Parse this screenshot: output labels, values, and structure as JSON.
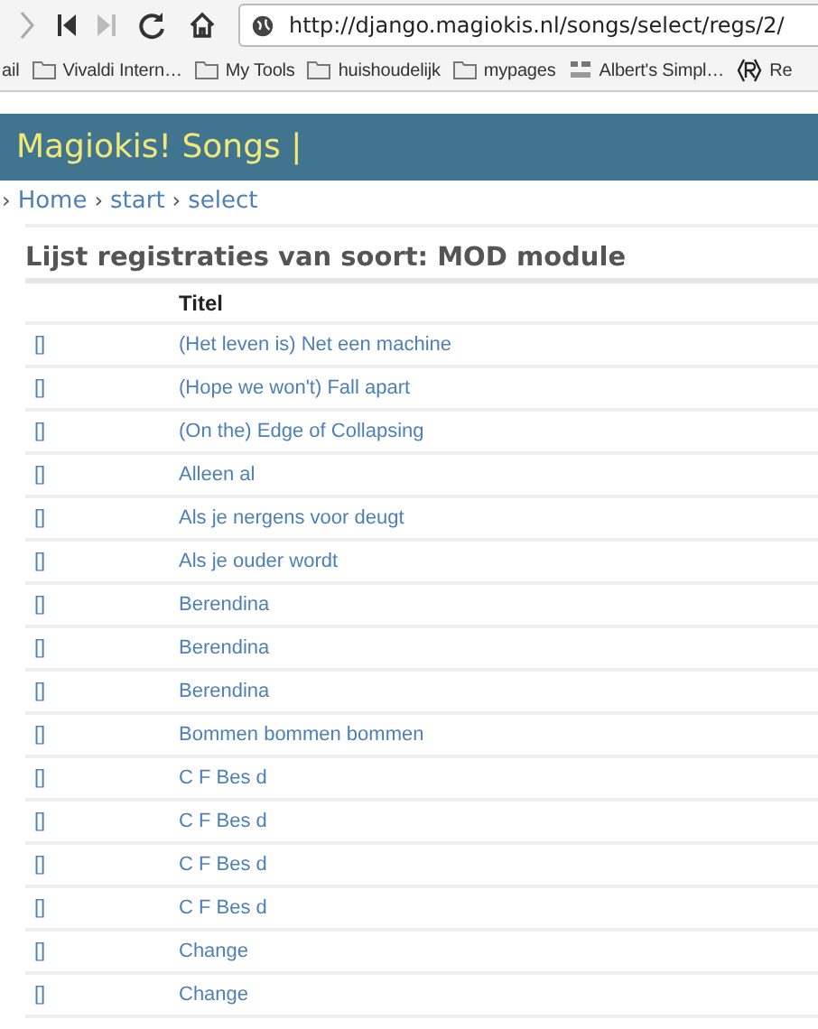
{
  "browser": {
    "url": "http://django.magiokis.nl/songs/select/regs/2/",
    "bookmarks": [
      {
        "label": "ail",
        "kind": "plain"
      },
      {
        "label": "Vivaldi Intern…",
        "kind": "folder"
      },
      {
        "label": "My Tools",
        "kind": "folder"
      },
      {
        "label": "huishoudelijk",
        "kind": "folder"
      },
      {
        "label": "mypages",
        "kind": "folder"
      },
      {
        "label": "Albert's Simpl…",
        "kind": "site"
      },
      {
        "label": "Re",
        "kind": "registered"
      }
    ]
  },
  "header": {
    "title": "Magiokis! Songs |"
  },
  "breadcrumb": {
    "separator": "›",
    "items": [
      "Home",
      "start",
      "select"
    ]
  },
  "heading": "Lijst registraties van soort: MOD module",
  "table": {
    "columns": [
      "Titel"
    ],
    "rows": [
      {
        "link": "[]",
        "title": "(Het leven is) Net een machine"
      },
      {
        "link": "[]",
        "title": "(Hope we won't) Fall apart"
      },
      {
        "link": "[]",
        "title": "(On the) Edge of Collapsing"
      },
      {
        "link": "[]",
        "title": "Alleen al"
      },
      {
        "link": "[]",
        "title": "Als je nergens voor deugt"
      },
      {
        "link": "[]",
        "title": "Als je ouder wordt"
      },
      {
        "link": "[]",
        "title": "Berendina"
      },
      {
        "link": "[]",
        "title": "Berendina"
      },
      {
        "link": "[]",
        "title": "Berendina"
      },
      {
        "link": "[]",
        "title": "Bommen bommen bommen"
      },
      {
        "link": "[]",
        "title": "C F Bes d"
      },
      {
        "link": "[]",
        "title": "C F Bes d"
      },
      {
        "link": "[]",
        "title": "C F Bes d"
      },
      {
        "link": "[]",
        "title": "C F Bes d"
      },
      {
        "link": "[]",
        "title": "Change"
      },
      {
        "link": "[]",
        "title": "Change"
      }
    ]
  }
}
